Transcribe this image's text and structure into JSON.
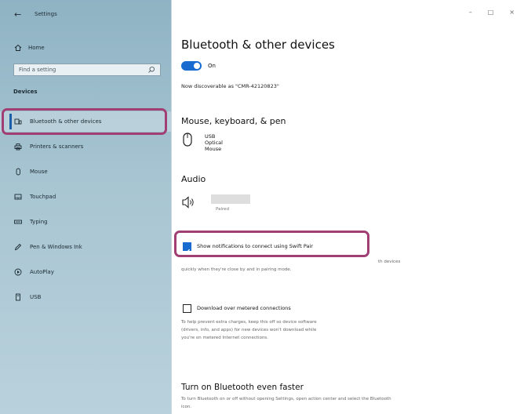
{
  "window": {
    "title": "Settings",
    "back_icon": "back-arrow-icon",
    "controls": [
      "–",
      "□",
      "×"
    ]
  },
  "sidebar": {
    "home_label": "Home",
    "search_placeholder": "Find a setting",
    "section_heading": "Devices",
    "items": [
      {
        "label": "Bluetooth & other devices",
        "icon": "bluetooth-devices-icon",
        "selected": true
      },
      {
        "label": "Printers & scanners",
        "icon": "printer-icon",
        "selected": false
      },
      {
        "label": "Mouse",
        "icon": "mouse-icon",
        "selected": false
      },
      {
        "label": "Touchpad",
        "icon": "touchpad-icon",
        "selected": false
      },
      {
        "label": "Typing",
        "icon": "keyboard-icon",
        "selected": false
      },
      {
        "label": "Pen & Windows Ink",
        "icon": "pen-icon",
        "selected": false
      },
      {
        "label": "AutoPlay",
        "icon": "autoplay-icon",
        "selected": false
      },
      {
        "label": "USB",
        "icon": "usb-icon",
        "selected": false
      }
    ]
  },
  "main": {
    "title": "Bluetooth & other devices",
    "bluetooth_toggle": {
      "state_label": "On",
      "on": true
    },
    "discoverable_text": "Now discoverable as \"CMR-42120823\"",
    "mouse_section": {
      "title": "Mouse, keyboard, & pen",
      "device_name": "USB Optical Mouse"
    },
    "audio_section": {
      "title": "Audio",
      "device_status": "Paired"
    },
    "swift_pair": {
      "label": "Show notifications to connect using Swift Pair",
      "checked": true,
      "desc_line1": "th devices",
      "desc_line2": "quickly when they're close by and in pairing mode."
    },
    "metered": {
      "label": "Download over metered connections",
      "checked": false,
      "desc_lines": [
        "To help prevent extra charges, keep this off so device software",
        "(drivers, info, and apps) for new devices won't download while",
        "you're on metered Internet connections."
      ]
    },
    "faster": {
      "title": "Turn on Bluetooth even faster",
      "desc_lines": [
        "To turn Bluetooth on or off without opening Settings, open action center and select the Bluetooth",
        "icon."
      ]
    }
  },
  "colors": {
    "accent": "#1a6bd0",
    "callout": "#a13e73",
    "sidebar_top": "#8fb3c4"
  }
}
